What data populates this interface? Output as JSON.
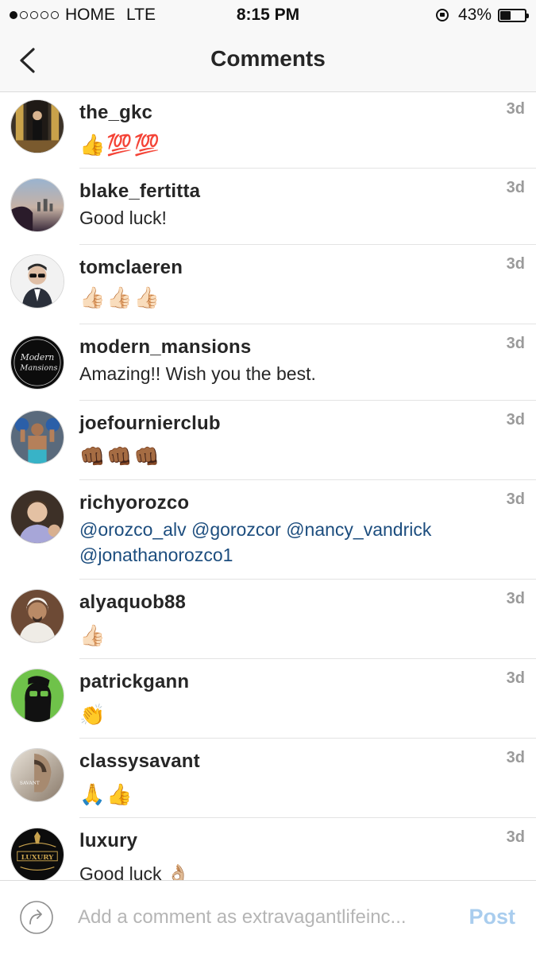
{
  "status_bar": {
    "carrier": "HOME",
    "network": "LTE",
    "time": "8:15 PM",
    "battery": "43%",
    "battery_level": 0.43,
    "signal_bars_filled": 1,
    "signal_bars_total": 5
  },
  "nav": {
    "title": "Comments",
    "back_icon": "chevron-left-icon"
  },
  "comments": [
    {
      "username": "the_gkc",
      "text": "👍💯💯",
      "time": "3d",
      "avatar": "the-gkc-avatar",
      "kind": "emoji"
    },
    {
      "username": "blake_fertitta",
      "text": "Good luck!",
      "time": "3d",
      "avatar": "blake-fertitta-avatar",
      "kind": "text"
    },
    {
      "username": "tomclaeren",
      "text": "👍🏻👍🏻👍🏻",
      "time": "3d",
      "avatar": "tomclaeren-avatar",
      "kind": "emoji"
    },
    {
      "username": "modern_mansions",
      "text": "Amazing!! Wish you the best.",
      "time": "3d",
      "avatar": "modern-mansions-avatar",
      "kind": "text"
    },
    {
      "username": "joefournierclub",
      "text": "👊🏾👊🏾👊🏾",
      "time": "3d",
      "avatar": "joefournierclub-avatar",
      "kind": "emoji"
    },
    {
      "username": "richyorozco",
      "text_line1": "@orozco_alv @gorozcor @nancy_vandrick",
      "text_line2": "@jonathanorozco1",
      "time": "3d",
      "avatar": "richyorozco-avatar",
      "kind": "mentions"
    },
    {
      "username": "alyaquob88",
      "text": "👍🏻",
      "time": "3d",
      "avatar": "alyaquob88-avatar",
      "kind": "emoji"
    },
    {
      "username": "patrickgann",
      "text": "👏",
      "time": "3d",
      "avatar": "patrickgann-avatar",
      "kind": "emoji"
    },
    {
      "username": "classysavant",
      "text": "🙏👍",
      "time": "3d",
      "avatar": "classysavant-avatar",
      "kind": "emoji"
    },
    {
      "username": "luxury",
      "text": "Good luck 👌🏼",
      "time": "3d",
      "avatar": "luxury-avatar",
      "kind": "text"
    }
  ],
  "avatar_labels": {
    "modern_mansions_line1": "Modern",
    "modern_mansions_line2": "Mansions",
    "classysavant_mark": "SAVANT",
    "luxury_mark": "LUXURY"
  },
  "composer": {
    "placeholder": "Add a comment as extravagantlifeinc...",
    "post_label": "Post",
    "share_icon": "share-arrow-icon"
  },
  "colors": {
    "mention": "#1c4d7e",
    "timestamp": "#9a9a9a",
    "post_disabled": "#a9cdee",
    "bar_background": "#f8f8f8"
  }
}
